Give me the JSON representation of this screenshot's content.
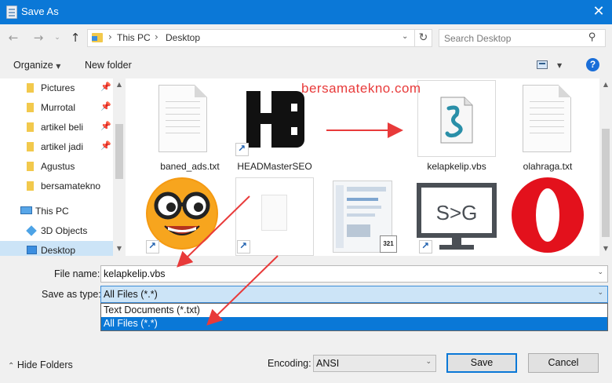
{
  "window": {
    "title": "Save As",
    "close": "✕"
  },
  "address": {
    "path": [
      "This PC",
      "Desktop"
    ],
    "separator": "›",
    "search_placeholder": "Search Desktop"
  },
  "toolbar": {
    "organize": "Organize",
    "new_folder": "New folder",
    "help": "?"
  },
  "sidebar": {
    "items": [
      {
        "label": "Pictures",
        "pinned": true
      },
      {
        "label": "Murrotal",
        "pinned": true
      },
      {
        "label": "artikel beli",
        "pinned": true
      },
      {
        "label": "artikel jadi",
        "pinned": true
      },
      {
        "label": "Agustus",
        "pinned": false
      },
      {
        "label": "bersamatekno",
        "pinned": false
      },
      {
        "label": "This PC",
        "pinned": false
      },
      {
        "label": "3D Objects",
        "pinned": false
      },
      {
        "label": "Desktop",
        "pinned": false,
        "selected": true
      }
    ]
  },
  "files": [
    {
      "name": "baned_ads.txt",
      "icon": "text-document-icon"
    },
    {
      "name": "HEADMasterSEO",
      "icon": "headmaster-seo-icon"
    },
    {
      "name": "kelapkelip.vbs",
      "icon": "vbs-script-icon"
    },
    {
      "name": "olahraga.txt",
      "icon": "text-document-icon"
    },
    {
      "name": "",
      "icon": "glasses-emoji-icon"
    },
    {
      "name": "",
      "icon": "blank-document-icon"
    },
    {
      "name": "",
      "icon": "screenshot-thumbnail-icon"
    },
    {
      "name": "",
      "icon": "s-to-g-monitor-icon"
    },
    {
      "name": "",
      "icon": "opera-icon"
    }
  ],
  "watermark": "bersamatekno.com",
  "form": {
    "filename_label": "File name:",
    "filename_value": "kelapkelip.vbs",
    "type_label": "Save as type:",
    "type_value": "All Files  (*.*)",
    "type_options": [
      "Text Documents (*.txt)",
      "All Files  (*.*)"
    ],
    "encoding_label": "Encoding:",
    "encoding_value": "ANSI"
  },
  "footer": {
    "hide_folders": "Hide Folders",
    "save": "Save",
    "cancel": "Cancel"
  },
  "colors": {
    "accent": "#0b78d7",
    "annotation": "#e83a3a",
    "selection": "#cce4f7"
  }
}
